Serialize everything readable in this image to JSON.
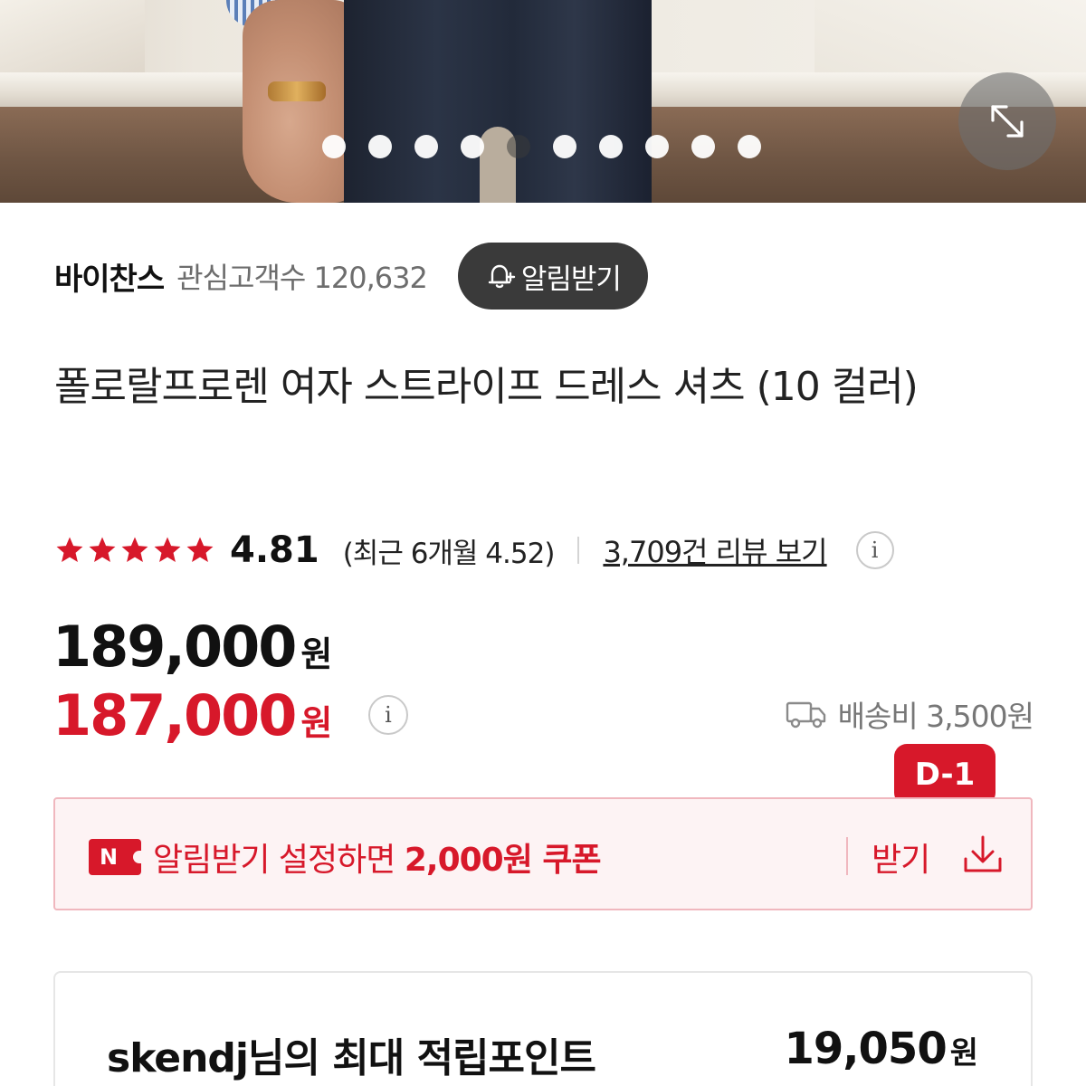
{
  "store": {
    "name": "바이찬스",
    "follower_label": "관심고객수 120,632",
    "notify_label": "알림받기"
  },
  "product": {
    "title": "폴로랄프로렌 여자 스트라이프 드레스 셔츠 (10 컬러)"
  },
  "gallery": {
    "image_count": 10,
    "active_index": 4
  },
  "rating": {
    "stars": 5,
    "score": "4.81",
    "recent": "(최근 6개월 4.52)",
    "review_link": "3,709건 리뷰 보기"
  },
  "price": {
    "original": "189,000",
    "original_unit": "원",
    "sale": "187,000",
    "sale_unit": "원"
  },
  "shipping": {
    "label": "배송비 3,500원"
  },
  "coupon": {
    "dday": "D-1",
    "badge": "N",
    "message_prefix": "알림받기 설정하면 ",
    "message_bold": "2,000원 쿠폰",
    "get_label": "받기"
  },
  "points": {
    "label": "skendj님의 최대 적립포인트",
    "value": "19,050",
    "unit": "원"
  },
  "colors": {
    "accent_red": "#d7182a",
    "dark_button": "#3a3a3a",
    "coupon_bg": "#fdf3f4",
    "coupon_border": "#f0b7be"
  },
  "icons": {
    "expand": "expand-arrows-icon",
    "bell": "bell-plus-icon",
    "info": "info-icon",
    "truck": "truck-icon",
    "download": "download-icon",
    "star": "star-icon"
  }
}
